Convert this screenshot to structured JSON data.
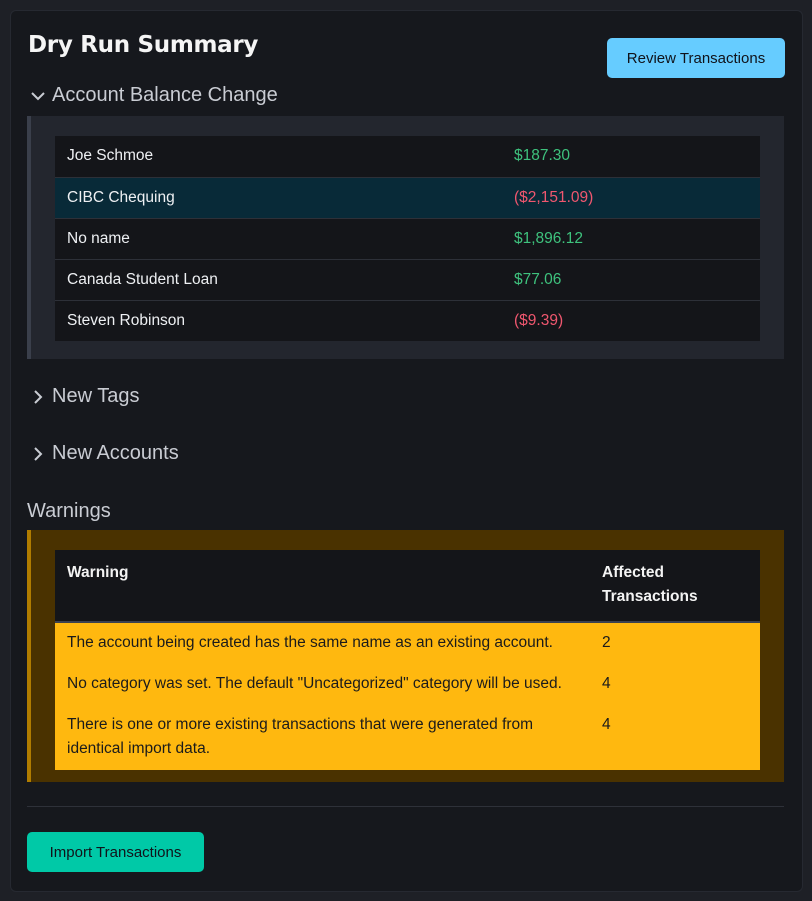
{
  "header": {
    "title": "Dry Run Summary",
    "review_button": "Review Transactions"
  },
  "balance_section": {
    "label": "Account Balance Change",
    "expanded": true,
    "rows": [
      {
        "name": "Joe Schmoe",
        "amount": "$187.30",
        "sign": "positive"
      },
      {
        "name": "CIBC Chequing",
        "amount": "($2,151.09)",
        "sign": "negative",
        "highlighted": true
      },
      {
        "name": "No name",
        "amount": "$1,896.12",
        "sign": "positive"
      },
      {
        "name": "Canada Student Loan",
        "amount": "$77.06",
        "sign": "positive"
      },
      {
        "name": "Steven Robinson",
        "amount": "($9.39)",
        "sign": "negative"
      }
    ]
  },
  "tags_section": {
    "label": "New Tags",
    "expanded": false
  },
  "accounts_section": {
    "label": "New Accounts",
    "expanded": false
  },
  "warnings": {
    "heading": "Warnings",
    "columns": [
      "Warning",
      "Affected Transactions"
    ],
    "rows": [
      {
        "warning": "The account being created has the same name as an existing account.",
        "affected": "2"
      },
      {
        "warning": "No category was set. The default \"Uncategorized\" category will be used.",
        "affected": "4"
      },
      {
        "warning": "There is one or more existing transactions that were generated from identical import data.",
        "affected": "4"
      }
    ]
  },
  "footer": {
    "import_button": "Import Transactions"
  },
  "colors": {
    "positive": "#3ec27d",
    "negative": "#f0576f",
    "primary_button": "#66ccff",
    "import_button": "#00c9a7",
    "warning_row": "#ffb80f"
  }
}
